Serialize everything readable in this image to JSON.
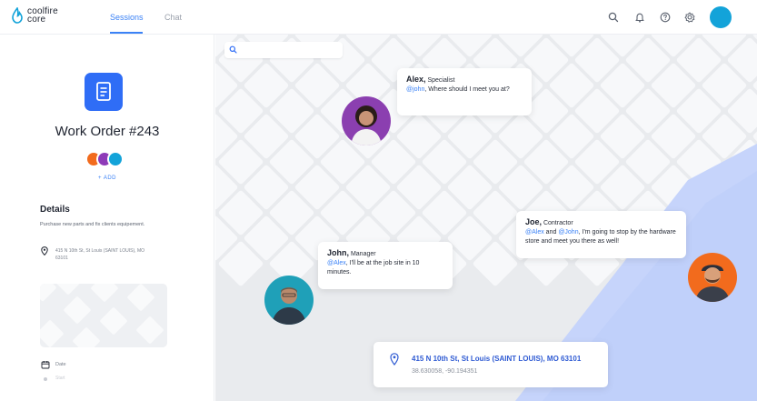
{
  "brand": {
    "line1": "coolfire",
    "line2": "core",
    "accent": "#3b82f6"
  },
  "nav": {
    "tabs": [
      {
        "label": "Sessions",
        "active": true
      },
      {
        "label": "Chat",
        "active": false
      }
    ]
  },
  "top_icons": [
    "search-icon",
    "bell-icon",
    "help-icon",
    "gear-icon"
  ],
  "sidebar": {
    "title": "Work Order #243",
    "add_label": "+ ADD",
    "details_heading": "Details",
    "details_text": "Purchase new parts and fix clients equipement.",
    "location": "415 N 10th St, St Louis (SAINT LOUIS), MO 63101",
    "date_label": "Date",
    "start_label": "Start",
    "participant_colors": [
      "#f26b1d",
      "#8e3bb8",
      "#13a3d9"
    ]
  },
  "map": {
    "search_placeholder": "",
    "messages": [
      {
        "name": "Alex,",
        "role": "Specialist",
        "mention": "@john",
        "text": ", Where should I meet you at?"
      },
      {
        "name": "John,",
        "role": "Manager",
        "mention": "@Alex",
        "text": ", I'll be at the job site in 10 minutes."
      },
      {
        "name": "Joe,",
        "role": "Contractor",
        "mention1": "@Alex",
        "and": " and ",
        "mention2": "@John",
        "text": ", I'm going to stop by the hardware store and meet you there as well!"
      }
    ],
    "address": "415 N 10th St, St Louis (SAINT LOUIS), MO 63101",
    "coordinates": "38.630058, -90.194351"
  }
}
